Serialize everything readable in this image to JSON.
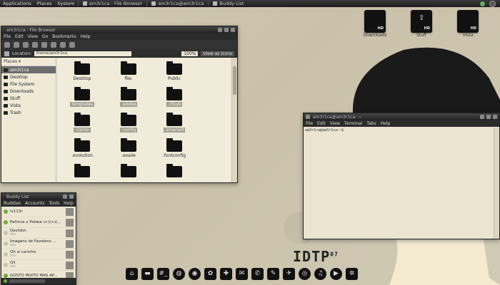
{
  "top_panel": {
    "menus": [
      "Applications",
      "Places",
      "System"
    ],
    "tasks": [
      "am3r1ca - File Browser",
      "am3r1ca@am3r1ca",
      "Buddy List"
    ]
  },
  "desktop_drives": [
    {
      "name": "Downloads",
      "badge": "HD"
    },
    {
      "name": "Stuff",
      "badge": "HD"
    },
    {
      "name": "Vista",
      "badge": "HD"
    }
  ],
  "file_browser": {
    "title": "am3r1ca - File Browser",
    "menu": [
      "File",
      "Edit",
      "View",
      "Go",
      "Bookmarks",
      "Help"
    ],
    "location_label": "Location:",
    "location_value": "/home/am3r1ca",
    "zoom": "100%",
    "view_as": "View as Icons",
    "places_header": "Places ▾",
    "places": [
      "am3r1ca",
      "Desktop",
      "File System",
      "Downloads",
      "Stuff",
      "Vista",
      "Trash"
    ],
    "files": [
      {
        "name": "Desktop",
        "hidden": false
      },
      {
        "name": "file:",
        "hidden": false
      },
      {
        "name": "Public",
        "hidden": false
      },
      {
        "name": "Templates",
        "hidden": true
      },
      {
        "name": ".adobe",
        "hidden": true
      },
      {
        "name": ".cfsub",
        "hidden": true
      },
      {
        "name": ".cache",
        "hidden": true
      },
      {
        "name": ".config",
        "hidden": true
      },
      {
        "name": ".emerald",
        "hidden": true
      },
      {
        "name": ".evolution",
        "hidden": false
      },
      {
        "name": ".exaile",
        "hidden": false
      },
      {
        "name": ".fontconfig",
        "hidden": false
      }
    ]
  },
  "buddy_list": {
    "title": "Buddy List",
    "menu": [
      "Buddies",
      "Accounts",
      "Tools",
      "Help"
    ],
    "buddies": [
      {
        "name": "lv113r",
        "status": "",
        "online": true
      },
      {
        "name": "Patricia u Polska (+)(+)(...",
        "status": "",
        "online": true
      },
      {
        "name": "Davidon",
        "status": "Idle",
        "online": false
      },
      {
        "name": "Imagens de Faveiens ...",
        "status": "Idle",
        "online": false
      },
      {
        "name": "Oh si carinho",
        "status": "Idle",
        "online": false
      },
      {
        "name": "Oli",
        "status": "Idle",
        "online": false
      },
      {
        "name": "GOSTO MUITO MAS AP...",
        "status": "",
        "online": true
      }
    ]
  },
  "terminal": {
    "title": "am3r1ca@am3r1ca: ~",
    "menu": [
      "File",
      "Edit",
      "View",
      "Terminal",
      "Tabs",
      "Help"
    ],
    "prompt": "am3r1ca@am3r1ca:~$"
  },
  "logo": {
    "text": "IDTP",
    "sup": "07"
  },
  "colors": {
    "wallpaper": "#cfc7b0",
    "panel": "#1c1c1c",
    "accent_green": "#6cae3c"
  }
}
